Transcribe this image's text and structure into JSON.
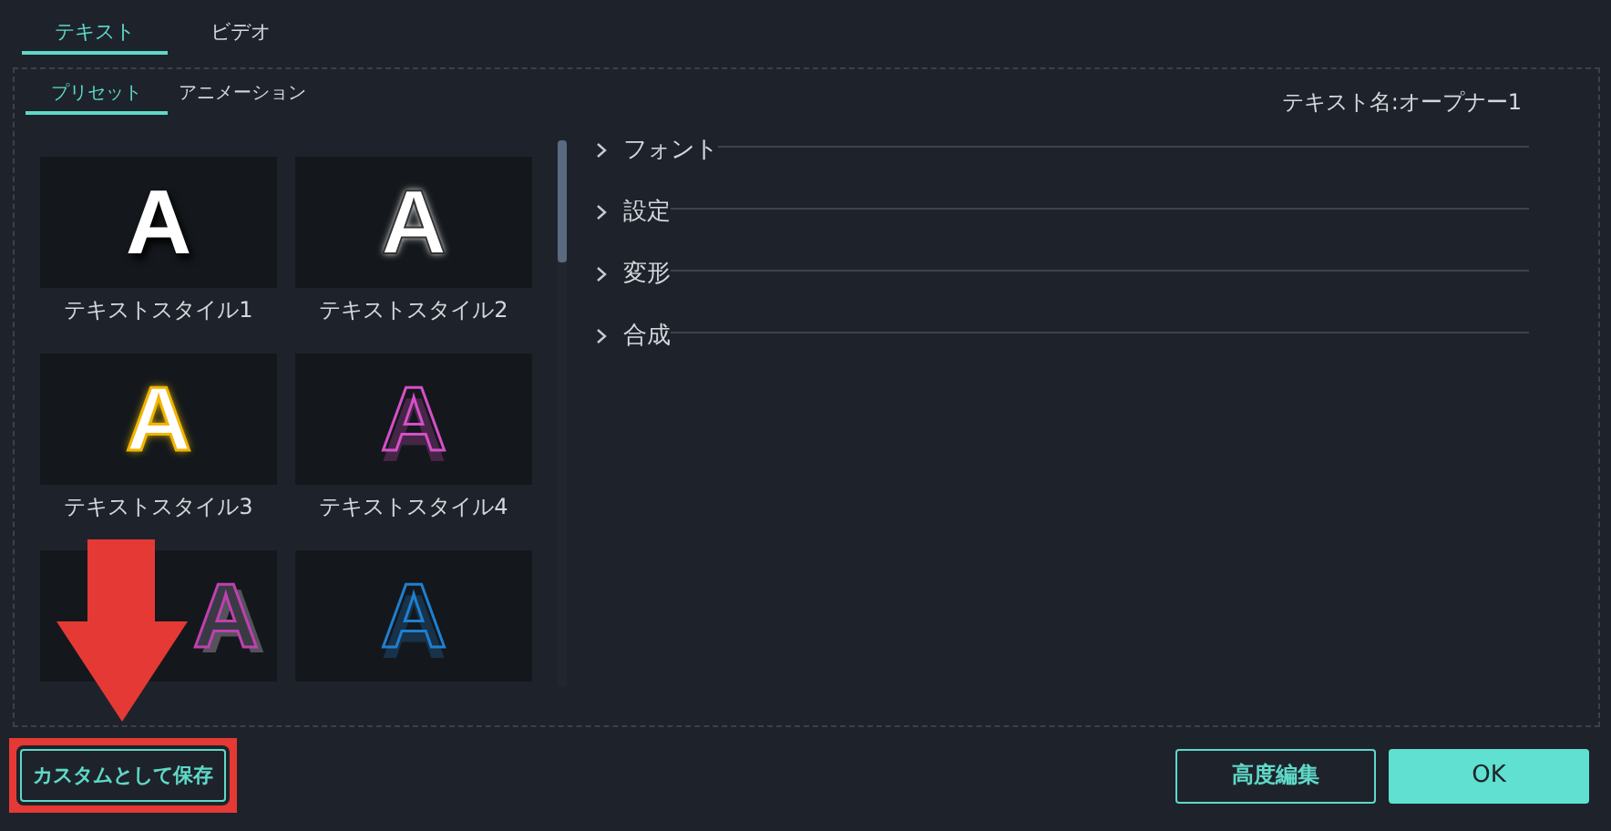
{
  "tabs": [
    {
      "label": "テキスト",
      "selected": true
    },
    {
      "label": "ビデオ",
      "selected": false
    }
  ],
  "subtabs": [
    {
      "label": "プリセット",
      "selected": true
    },
    {
      "label": "アニメーション",
      "selected": false
    }
  ],
  "text_name": "テキスト名:オープナー1",
  "presets": [
    {
      "label": "テキストスタイル1",
      "preview": "A",
      "kind": "shadow"
    },
    {
      "label": "テキストスタイル2",
      "preview": "A",
      "kind": "glow"
    },
    {
      "label": "テキストスタイル3",
      "preview": "A",
      "kind": "gold"
    },
    {
      "label": "テキストスタイル4",
      "preview": "A",
      "kind": "pink"
    },
    {
      "preview": "A",
      "kind": "pink3d"
    },
    {
      "preview": "A",
      "kind": "blue"
    }
  ],
  "sections": [
    {
      "label": "フォント",
      "expanded": false
    },
    {
      "label": "設定",
      "expanded": false
    },
    {
      "label": "変形",
      "expanded": false
    },
    {
      "label": "合成",
      "expanded": false
    }
  ],
  "save_button": {
    "label": "カスタムとして保存",
    "highlighted": true
  },
  "advanced_button": {
    "label": "高度編集"
  },
  "ok_button": {
    "label": "OK"
  }
}
